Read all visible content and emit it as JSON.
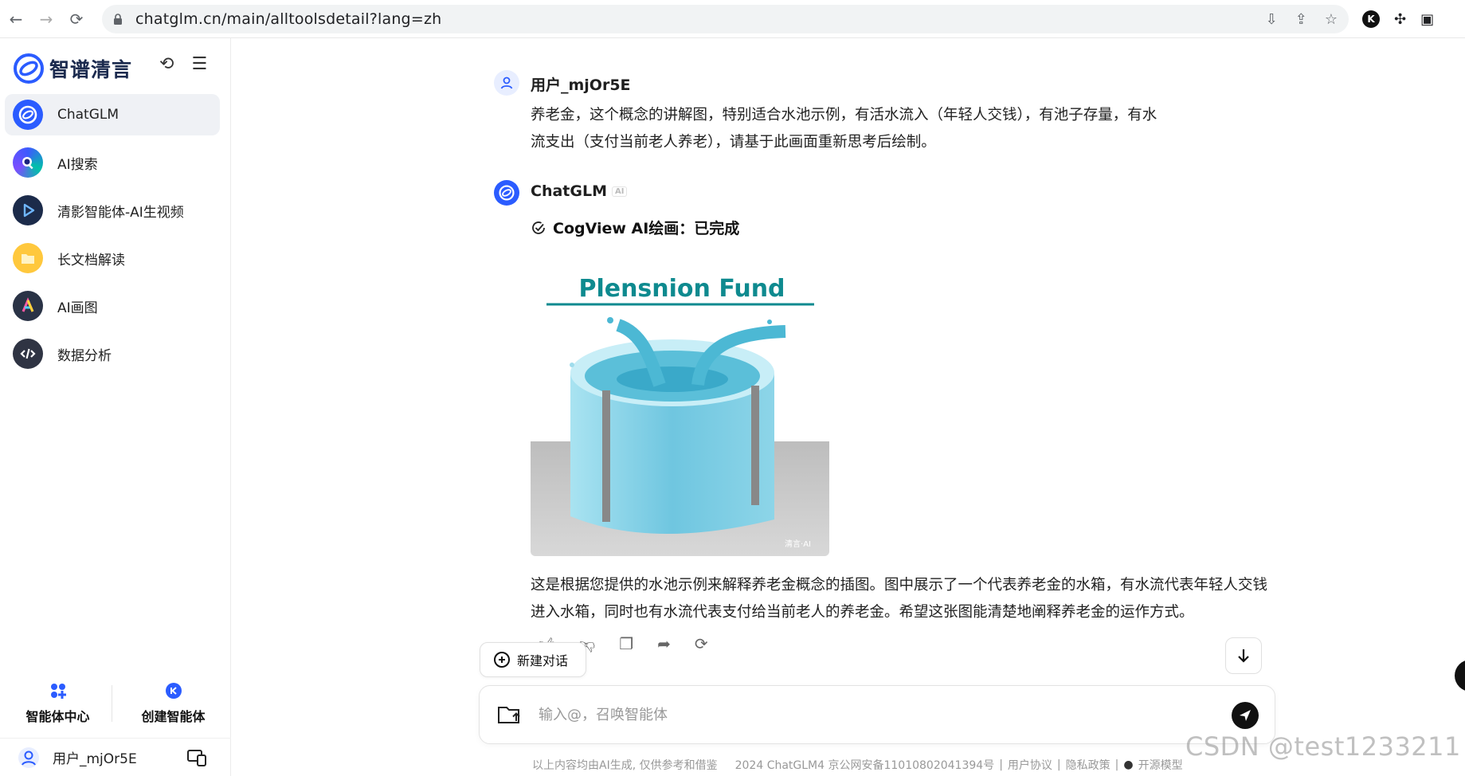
{
  "browser": {
    "url": "chatglm.cn/main/alltoolsdetail?lang=zh",
    "extension_letter": "K"
  },
  "sidebar": {
    "brand_name": "智谱清言",
    "items": [
      {
        "label": "ChatGLM",
        "icon": "chatglm-logo-icon",
        "active": true
      },
      {
        "label": "AI搜索",
        "icon": "ai-search-icon"
      },
      {
        "label": "清影智能体-AI生视频",
        "icon": "video-play-icon"
      },
      {
        "label": "长文档解读",
        "icon": "folder-icon"
      },
      {
        "label": "AI画图",
        "icon": "ai-draw-icon"
      },
      {
        "label": "数据分析",
        "icon": "code-icon"
      }
    ],
    "bottom": {
      "agent_center": "智能体中心",
      "create_agent": "创建智能体"
    },
    "user_name": "用户_mjOr5E"
  },
  "chat": {
    "user_name": "用户_mjOr5E",
    "user_message": "养老金，这个概念的讲解图，特别适合水池示例，有活水流入（年轻人交钱），有池子存量，有水流支出（支付当前老人养老），请基于此画面重新思考后绘制。",
    "assistant_name": "ChatGLM",
    "ai_tag": "AI",
    "tool_status": "CogView AI绘画：已完成",
    "image": {
      "title": "Plensnion Fund",
      "watermark": "清言·AI"
    },
    "assistant_message": "这是根据您提供的水池示例来解释养老金概念的插图。图中展示了一个代表养老金的水箱，有水流代表年轻人交钱进入水箱，同时也有水流代表支付给当前老人的养老金。希望这张图能清楚地阐释养老金的运作方式。"
  },
  "new_chat_label": "新建对话",
  "composer": {
    "placeholder": "输入@，召唤智能体"
  },
  "footer": {
    "disclaimer": "以上内容均由AI生成, 仅供参考和借鉴",
    "icp": "2024 ChatGLM4 京公网安备11010802041394号",
    "user_agreement": "用户协议",
    "privacy": "隐私政策",
    "open_source": "开源模型"
  },
  "watermark": "CSDN @test1233211",
  "colors": {
    "brand_blue": "#2b5cff",
    "water": "#7fd0e6",
    "title_teal": "#0e8a8f"
  }
}
